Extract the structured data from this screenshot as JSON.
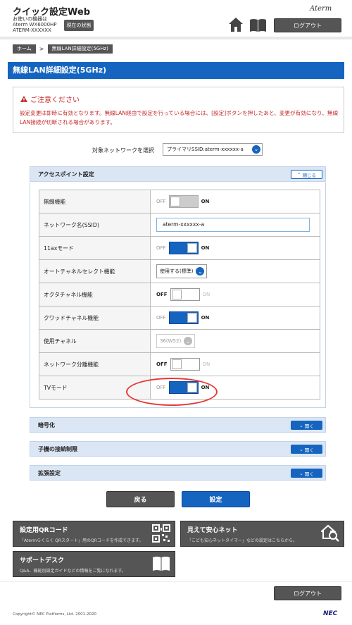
{
  "header": {
    "app_title": "クイック設定Web",
    "device_line1": "お使いの機器は",
    "device_line2": "Aterm WX6000HP",
    "device_line3": "ATERM-XXXXXX",
    "status_button": "現在の状態",
    "brand": "Aterm",
    "logout": "ログアウト"
  },
  "breadcrumb": {
    "home": "ホーム",
    "sep": ">",
    "current": "無線LAN詳細設定(5GHz)"
  },
  "page_title": "無線LAN詳細設定(5GHz)",
  "caution": {
    "title": "ご注意ください",
    "text": "設定変更は即時に有効となります。無線LAN経由で設定を行っている場合には、[設定]ボタンを押したあと、変更が有効になり、無線LAN接続が切断される場合があります。"
  },
  "network_select": {
    "label": "対象ネットワークを選択",
    "value": "プライマリSSID:aterm-xxxxxx-a"
  },
  "ap_section": {
    "title": "アクセスポイント設定",
    "close_label": "閉じる",
    "rows": [
      {
        "label": "無線機能",
        "type": "switch",
        "state": "on",
        "disabled": true
      },
      {
        "label": "ネットワーク名(SSID)",
        "type": "input",
        "value": "aterm-xxxxxx-a"
      },
      {
        "label": "11axモード",
        "type": "switch",
        "state": "on"
      },
      {
        "label": "オートチャネルセレクト機能",
        "type": "select",
        "value": "使用する(標準)"
      },
      {
        "label": "オクタチャネル機能",
        "type": "switch",
        "state": "off"
      },
      {
        "label": "クワッドチャネル機能",
        "type": "switch",
        "state": "on"
      },
      {
        "label": "使用チャネル",
        "type": "select",
        "value": "36(W52)",
        "disabled": true
      },
      {
        "label": "ネットワーク分離機能",
        "type": "switch",
        "state": "off"
      },
      {
        "label": "TVモード",
        "type": "switch",
        "state": "on"
      }
    ],
    "off": "OFF",
    "on": "ON"
  },
  "collapsed_sections": [
    {
      "title": "暗号化",
      "open_label": "開く"
    },
    {
      "title": "子機の接続制限",
      "open_label": "開く"
    },
    {
      "title": "拡張設定",
      "open_label": "開く"
    }
  ],
  "actions": {
    "back": "戻る",
    "set": "設定"
  },
  "tiles": {
    "qr": {
      "title": "設定用QRコード",
      "desc": "「Atermらくらく QRスタート」用のQRコードを作成できます。"
    },
    "safe": {
      "title": "見えて安心ネット",
      "desc": "「こども安心ネットタイマー」などの設定はこちらから。"
    },
    "support": {
      "title": "サポートデスク",
      "desc": "Q&A、機能別設定ガイドなどの情報をご覧になれます。"
    }
  },
  "footer": {
    "copyright": "Copyright© NEC Platforms, Ltd. 2001-2020",
    "logo": "NEC",
    "logout": "ログアウト"
  },
  "colors": {
    "accent": "#1565c0",
    "caution": "#c62828",
    "dark_button": "#555555",
    "highlight_ring": "#e53935"
  }
}
